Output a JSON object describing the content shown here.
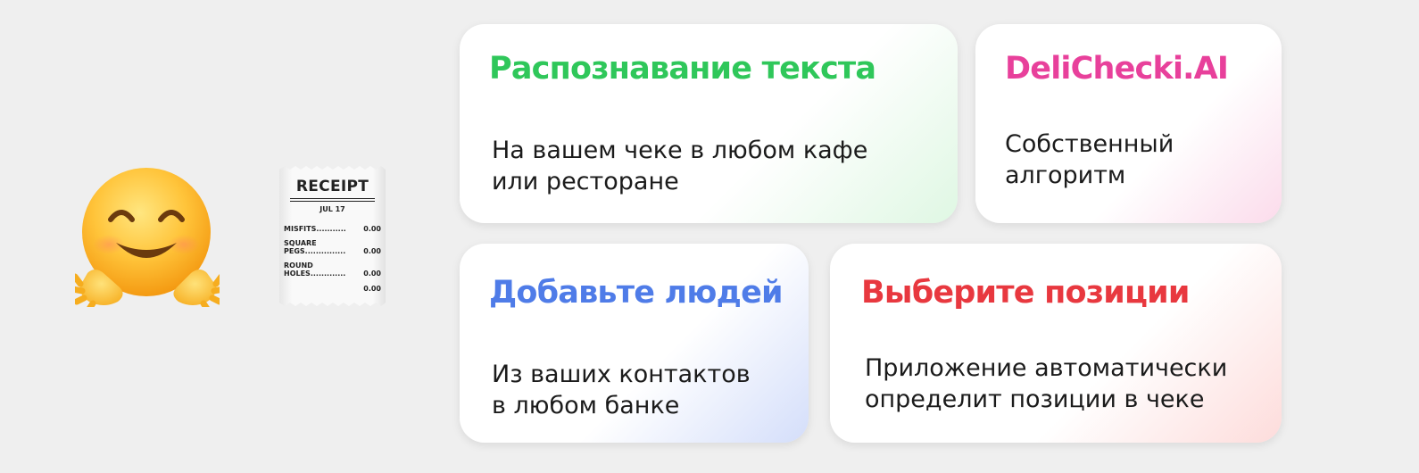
{
  "illustrations": {
    "emoji_icon": "hugging-face-icon",
    "receipt_icon": "receipt-icon",
    "receipt": {
      "title": "RECEIPT",
      "date": "JUL 17",
      "items": [
        {
          "label": "MISFITS...........",
          "price": "0.00"
        },
        {
          "label": "SQUARE\nPEGS...............",
          "price": "0.00"
        },
        {
          "label": "ROUND\nHOLES.............",
          "price": "0.00"
        }
      ],
      "total": "0.00"
    }
  },
  "cards": {
    "text_recognition": {
      "title": "Распознавание текста",
      "body_line1": "На вашем чеке в любом кафе",
      "body_line2": "или ресторане",
      "accent": "#2fc75a"
    },
    "brand": {
      "title": "DeliChecki.AI",
      "body_line1": "Собственный",
      "body_line2": "алгоритм",
      "accent": "#e8409b"
    },
    "add_people": {
      "title": "Добавьте людей",
      "body_line1": "Из ваших контактов",
      "body_line2": "в любом банке",
      "accent": "#4f7ce8"
    },
    "select_items": {
      "title": "Выберите позиции",
      "body_line1": "Приложение автоматически",
      "body_line2": "определит позиции в чеке",
      "accent": "#e8383f"
    }
  }
}
